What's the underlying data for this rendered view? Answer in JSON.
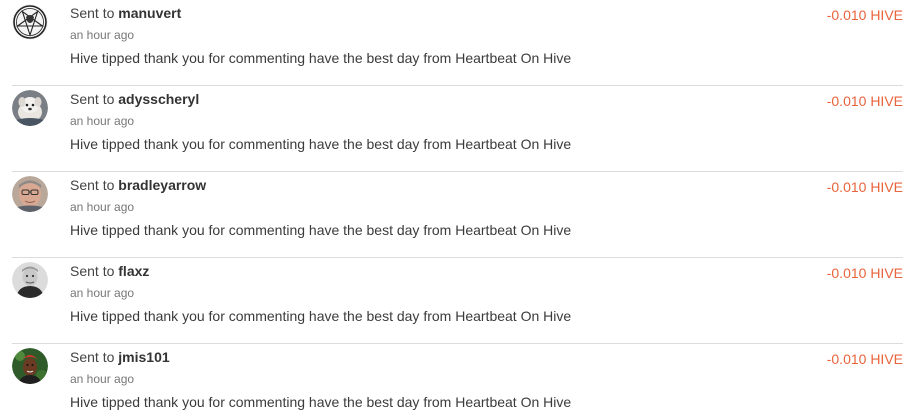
{
  "transactions": [
    {
      "sent_prefix": "Sent to",
      "username": "manuvert",
      "time": "an hour ago",
      "memo": "Hive tipped thank you for commenting have the best day from Heartbeat On Hive",
      "amount": "-0.010 HIVE",
      "avatar_icon": "pentagram-icon"
    },
    {
      "sent_prefix": "Sent to",
      "username": "adysscheryl",
      "time": "an hour ago",
      "memo": "Hive tipped thank you for commenting have the best day from Heartbeat On Hive",
      "amount": "-0.010 HIVE",
      "avatar_icon": "dog-avatar"
    },
    {
      "sent_prefix": "Sent to",
      "username": "bradleyarrow",
      "time": "an hour ago",
      "memo": "Hive tipped thank you for commenting have the best day from Heartbeat On Hive",
      "amount": "-0.010 HIVE",
      "avatar_icon": "man-glasses-avatar"
    },
    {
      "sent_prefix": "Sent to",
      "username": "flaxz",
      "time": "an hour ago",
      "memo": "Hive tipped thank you for commenting have the best day from Heartbeat On Hive",
      "amount": "-0.010 HIVE",
      "avatar_icon": "man-grayscale-avatar"
    },
    {
      "sent_prefix": "Sent to",
      "username": "jmis101",
      "time": "an hour ago",
      "memo": "Hive tipped thank you for commenting have the best day from Heartbeat On Hive",
      "amount": "-0.010 HIVE",
      "avatar_icon": "woman-red-headwrap-avatar"
    }
  ],
  "colors": {
    "amount": "#e8643c",
    "divider": "#dcdcdc",
    "muted": "#777777"
  }
}
